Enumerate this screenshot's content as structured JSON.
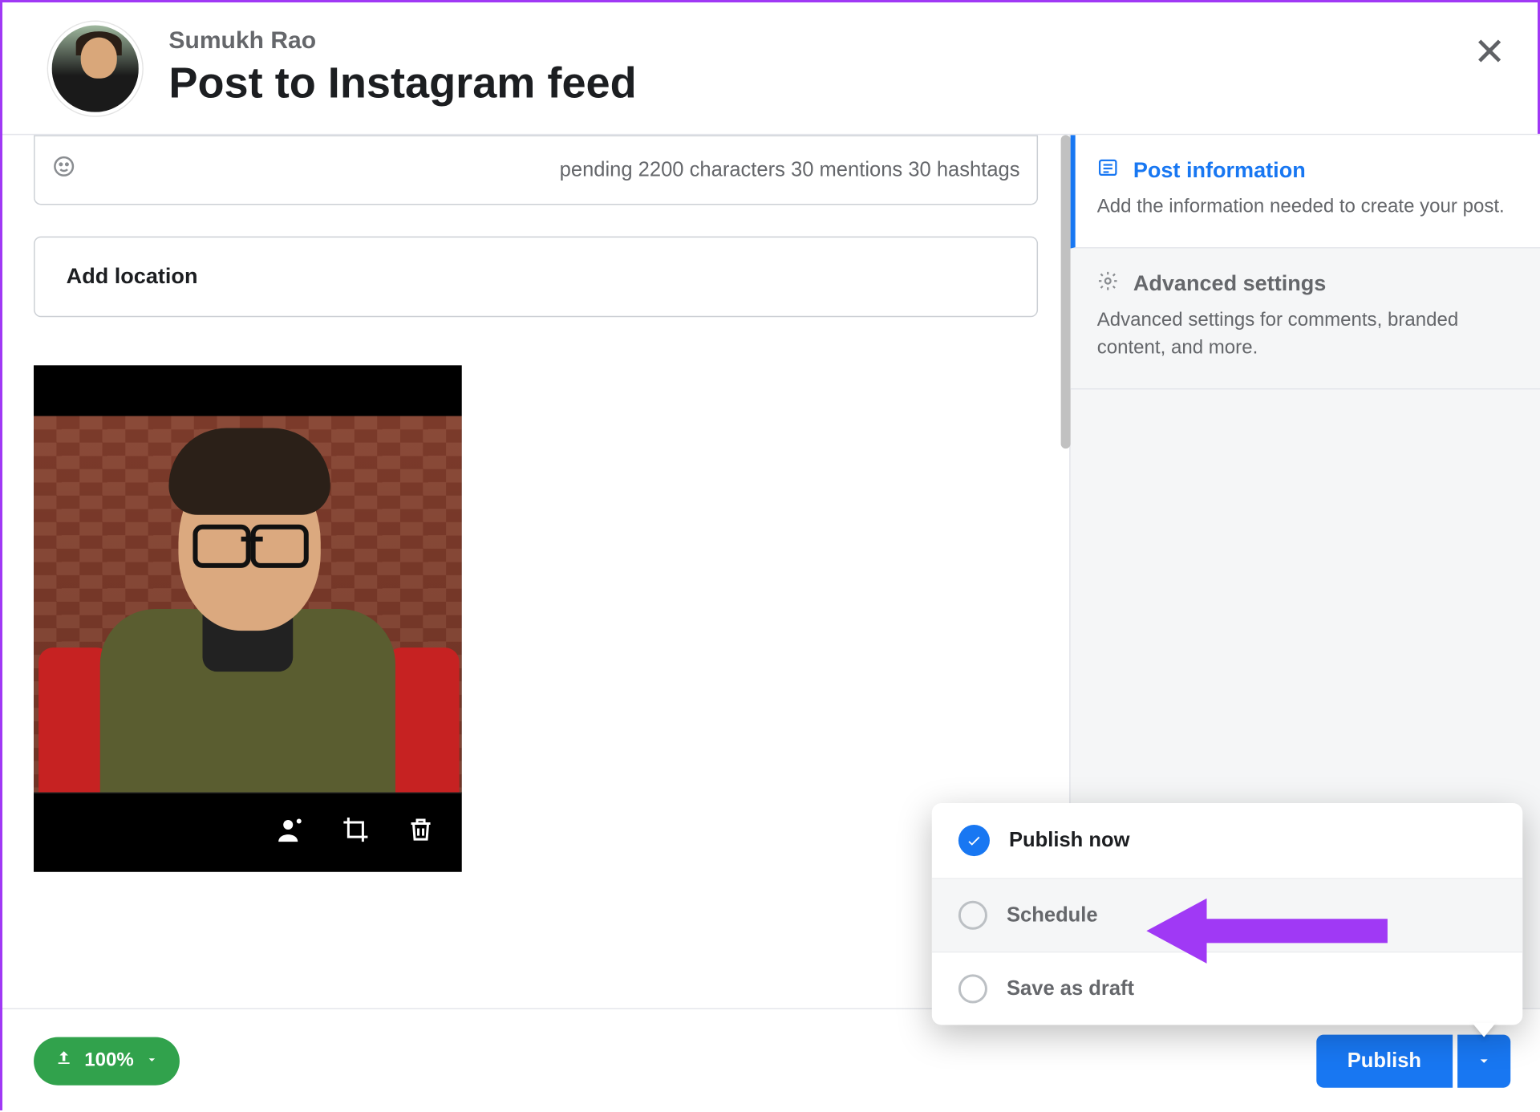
{
  "header": {
    "user_name": "Sumukh Rao",
    "page_title": "Post to Instagram feed"
  },
  "caption": {
    "counter_text": "pending 2200 characters 30 mentions 30 hashtags"
  },
  "location": {
    "label": "Add location"
  },
  "sidebar": {
    "post_info": {
      "title": "Post information",
      "desc": "Add the information needed to create your post."
    },
    "advanced": {
      "title": "Advanced settings",
      "desc": "Advanced settings for comments, branded content, and more."
    }
  },
  "publish_menu": {
    "publish_now": "Publish now",
    "schedule": "Schedule",
    "save_draft": "Save as draft"
  },
  "footer": {
    "upload_percent": "100%",
    "publish_label": "Publish"
  }
}
